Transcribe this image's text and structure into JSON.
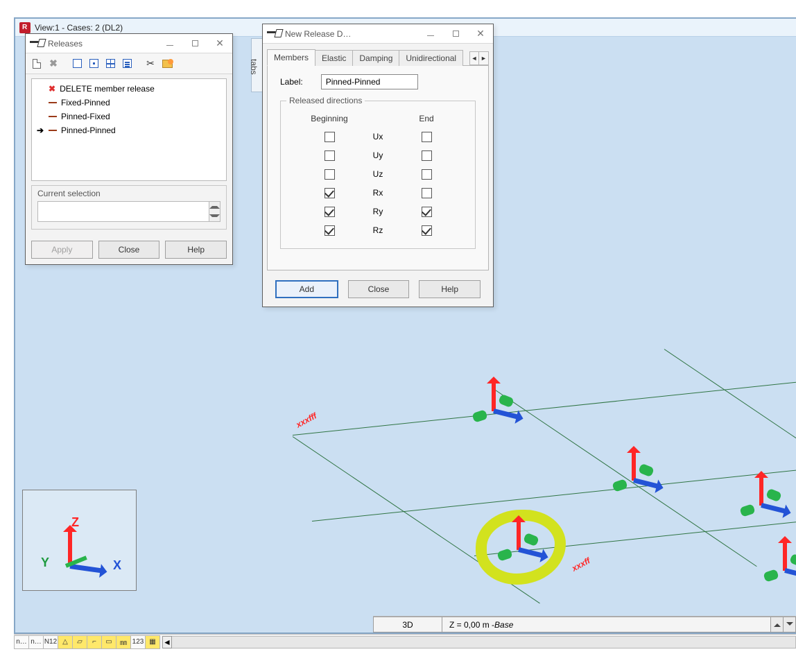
{
  "mainView": {
    "title": "View:1 - Cases: 2 (DL2)",
    "tabsHandle": "tabs",
    "axisTriad": {
      "x": "X",
      "y": "Y",
      "z": "Z"
    },
    "labels": {
      "left": "xxxfff",
      "right": "xxxff"
    },
    "status": {
      "mode": "3D",
      "coordText": "Z = 0,00 m - ",
      "coordBase": "Base"
    }
  },
  "bottomToolbar": {
    "scrollLeft": "◄",
    "buttons": [
      "n…",
      "n…",
      "N12",
      "△",
      "▱",
      "⌐",
      "▭",
      "㎜",
      "123",
      "▦"
    ]
  },
  "releasesDialog": {
    "title": "Releases",
    "list": [
      {
        "marker": "X",
        "label": "DELETE member release",
        "selected": false,
        "red": true
      },
      {
        "marker": "−",
        "label": "Fixed-Pinned",
        "selected": false
      },
      {
        "marker": "−",
        "label": "Pinned-Fixed",
        "selected": false
      },
      {
        "marker": "−",
        "label": "Pinned-Pinned",
        "selected": true
      }
    ],
    "currentSelection": {
      "label": "Current selection",
      "value": ""
    },
    "buttons": {
      "apply": "Apply",
      "close": "Close",
      "help": "Help"
    }
  },
  "newReleaseDialog": {
    "title": "New Release D…",
    "tabs": [
      "Members",
      "Elastic",
      "Damping",
      "Unidirectional"
    ],
    "activeTab": 0,
    "labelField": {
      "label": "Label:",
      "value": "Pinned-Pinned"
    },
    "group": {
      "legend": "Released directions",
      "cols": {
        "beginning": "Beginning",
        "end": "End"
      },
      "rows": [
        {
          "name": "Ux",
          "beg": false,
          "end": false
        },
        {
          "name": "Uy",
          "beg": false,
          "end": false
        },
        {
          "name": "Uz",
          "beg": false,
          "end": false
        },
        {
          "name": "Rx",
          "beg": true,
          "end": false
        },
        {
          "name": "Ry",
          "beg": true,
          "end": true
        },
        {
          "name": "Rz",
          "beg": true,
          "end": true
        }
      ]
    },
    "buttons": {
      "add": "Add",
      "close": "Close",
      "help": "Help"
    }
  }
}
